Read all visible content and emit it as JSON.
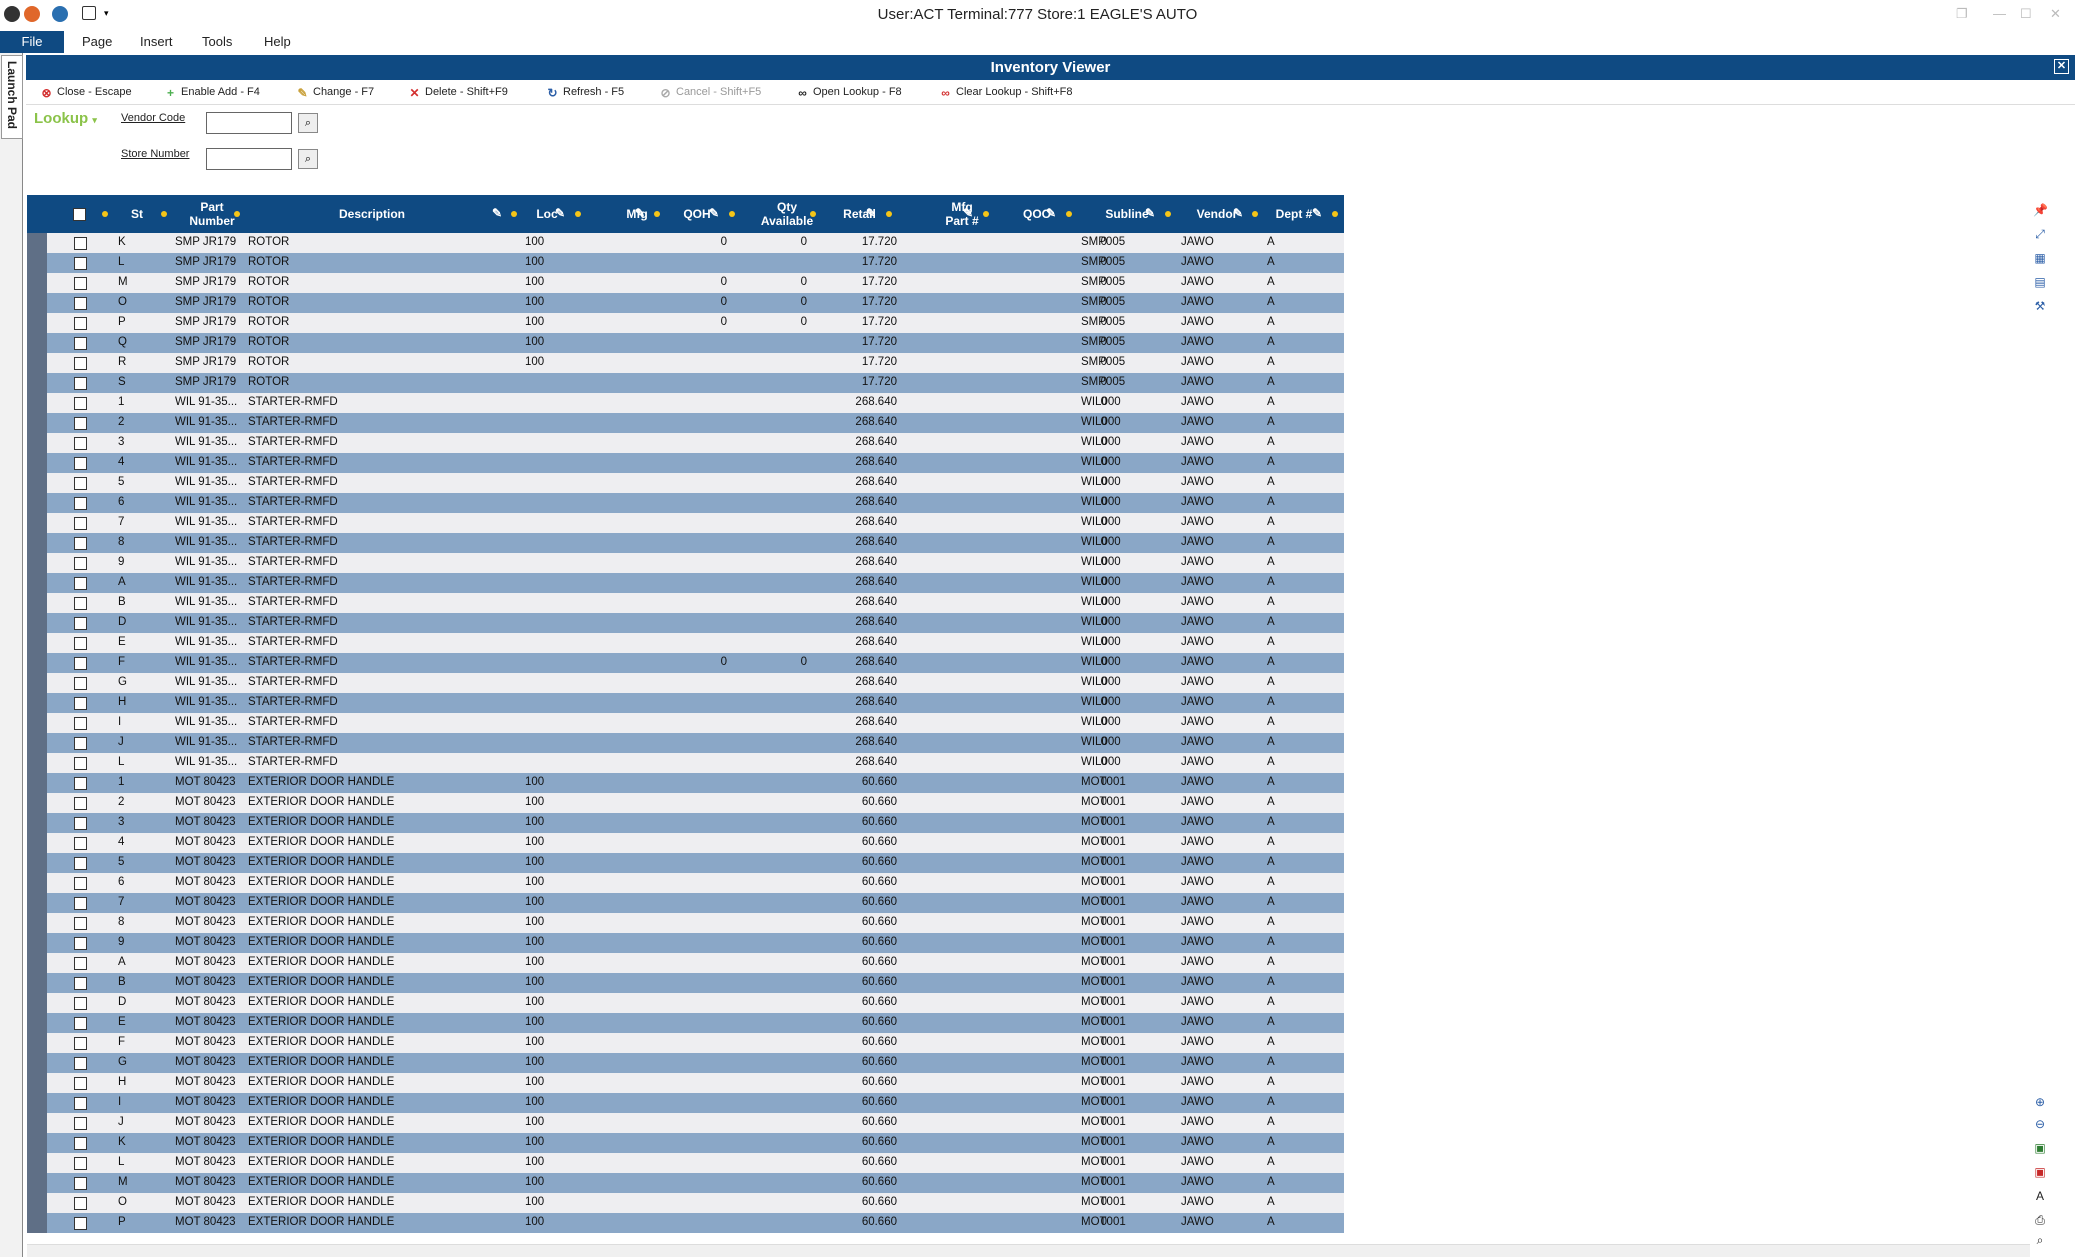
{
  "window": {
    "title": "User:ACT Terminal:777 Store:1 EAGLE'S AUTO"
  },
  "menu": {
    "file": "File",
    "page": "Page",
    "insert": "Insert",
    "tools": "Tools",
    "help": "Help"
  },
  "launch_pad": "Launch Pad",
  "panel": {
    "title": "Inventory Viewer",
    "close": "✕"
  },
  "toolbar": {
    "close": "Close - Escape",
    "enable_add": "Enable Add - F4",
    "change": "Change - F7",
    "delete": "Delete - Shift+F9",
    "refresh": "Refresh - F5",
    "cancel": "Cancel - Shift+F5",
    "open_lookup": "Open Lookup - F8",
    "clear_lookup": "Clear Lookup - Shift+F8"
  },
  "lookup": {
    "title": "Lookup",
    "vendor_code_label": "Vendor Code",
    "vendor_code_value": "",
    "store_number_label": "Store Number",
    "store_number_value": ""
  },
  "columns": {
    "st": "St",
    "part_number_1": "Part",
    "part_number_2": "Number",
    "description": "Description",
    "loc": "Loc",
    "mfg": "Mfg",
    "qoh": "QOH",
    "qty_available_1": "Qty",
    "qty_available_2": "Available",
    "retail": "Retail",
    "mfg_part_1": "Mfg",
    "mfg_part_2": "Part #",
    "qoo": "QOO",
    "subline": "Subline",
    "vendor": "Vendor",
    "dept": "Dept #"
  },
  "rows": [
    {
      "st": "K",
      "part": "SMP JR179",
      "desc": "ROTOR",
      "loc": "100",
      "qoh": "0",
      "qty": "0",
      "retail": "17.720",
      "qoo": "0",
      "subline": "SMP005",
      "vendor": "JAWO",
      "dept": "A"
    },
    {
      "st": "L",
      "part": "SMP JR179",
      "desc": "ROTOR",
      "loc": "100",
      "qoh": "",
      "qty": "",
      "retail": "17.720",
      "qoo": "0",
      "subline": "SMP005",
      "vendor": "JAWO",
      "dept": "A"
    },
    {
      "st": "M",
      "part": "SMP JR179",
      "desc": "ROTOR",
      "loc": "100",
      "qoh": "0",
      "qty": "0",
      "retail": "17.720",
      "qoo": "0",
      "subline": "SMP005",
      "vendor": "JAWO",
      "dept": "A"
    },
    {
      "st": "O",
      "part": "SMP JR179",
      "desc": "ROTOR",
      "loc": "100",
      "qoh": "0",
      "qty": "0",
      "retail": "17.720",
      "qoo": "0",
      "subline": "SMP005",
      "vendor": "JAWO",
      "dept": "A"
    },
    {
      "st": "P",
      "part": "SMP JR179",
      "desc": "ROTOR",
      "loc": "100",
      "qoh": "0",
      "qty": "0",
      "retail": "17.720",
      "qoo": "0",
      "subline": "SMP005",
      "vendor": "JAWO",
      "dept": "A"
    },
    {
      "st": "Q",
      "part": "SMP JR179",
      "desc": "ROTOR",
      "loc": "100",
      "qoh": "",
      "qty": "",
      "retail": "17.720",
      "qoo": "0",
      "subline": "SMP005",
      "vendor": "JAWO",
      "dept": "A"
    },
    {
      "st": "R",
      "part": "SMP JR179",
      "desc": "ROTOR",
      "loc": "100",
      "qoh": "",
      "qty": "",
      "retail": "17.720",
      "qoo": "0",
      "subline": "SMP005",
      "vendor": "JAWO",
      "dept": "A"
    },
    {
      "st": "S",
      "part": "SMP JR179",
      "desc": "ROTOR",
      "loc": "",
      "qoh": "",
      "qty": "",
      "retail": "17.720",
      "qoo": "0",
      "subline": "SMP005",
      "vendor": "JAWO",
      "dept": "A"
    },
    {
      "st": "1",
      "part": "WIL 91-35...",
      "desc": "STARTER-RMFD",
      "loc": "",
      "qoh": "",
      "qty": "",
      "retail": "268.640",
      "qoo": "0",
      "subline": "WIL000",
      "vendor": "JAWO",
      "dept": "A"
    },
    {
      "st": "2",
      "part": "WIL 91-35...",
      "desc": "STARTER-RMFD",
      "loc": "",
      "qoh": "",
      "qty": "",
      "retail": "268.640",
      "qoo": "0",
      "subline": "WIL000",
      "vendor": "JAWO",
      "dept": "A"
    },
    {
      "st": "3",
      "part": "WIL 91-35...",
      "desc": "STARTER-RMFD",
      "loc": "",
      "qoh": "",
      "qty": "",
      "retail": "268.640",
      "qoo": "0",
      "subline": "WIL000",
      "vendor": "JAWO",
      "dept": "A"
    },
    {
      "st": "4",
      "part": "WIL 91-35...",
      "desc": "STARTER-RMFD",
      "loc": "",
      "qoh": "",
      "qty": "",
      "retail": "268.640",
      "qoo": "0",
      "subline": "WIL000",
      "vendor": "JAWO",
      "dept": "A"
    },
    {
      "st": "5",
      "part": "WIL 91-35...",
      "desc": "STARTER-RMFD",
      "loc": "",
      "qoh": "",
      "qty": "",
      "retail": "268.640",
      "qoo": "0",
      "subline": "WIL000",
      "vendor": "JAWO",
      "dept": "A"
    },
    {
      "st": "6",
      "part": "WIL 91-35...",
      "desc": "STARTER-RMFD",
      "loc": "",
      "qoh": "",
      "qty": "",
      "retail": "268.640",
      "qoo": "0",
      "subline": "WIL000",
      "vendor": "JAWO",
      "dept": "A"
    },
    {
      "st": "7",
      "part": "WIL 91-35...",
      "desc": "STARTER-RMFD",
      "loc": "",
      "qoh": "",
      "qty": "",
      "retail": "268.640",
      "qoo": "0",
      "subline": "WIL000",
      "vendor": "JAWO",
      "dept": "A"
    },
    {
      "st": "8",
      "part": "WIL 91-35...",
      "desc": "STARTER-RMFD",
      "loc": "",
      "qoh": "",
      "qty": "",
      "retail": "268.640",
      "qoo": "0",
      "subline": "WIL000",
      "vendor": "JAWO",
      "dept": "A"
    },
    {
      "st": "9",
      "part": "WIL 91-35...",
      "desc": "STARTER-RMFD",
      "loc": "",
      "qoh": "",
      "qty": "",
      "retail": "268.640",
      "qoo": "0",
      "subline": "WIL000",
      "vendor": "JAWO",
      "dept": "A"
    },
    {
      "st": "A",
      "part": "WIL 91-35...",
      "desc": "STARTER-RMFD",
      "loc": "",
      "qoh": "",
      "qty": "",
      "retail": "268.640",
      "qoo": "0",
      "subline": "WIL000",
      "vendor": "JAWO",
      "dept": "A"
    },
    {
      "st": "B",
      "part": "WIL 91-35...",
      "desc": "STARTER-RMFD",
      "loc": "",
      "qoh": "",
      "qty": "",
      "retail": "268.640",
      "qoo": "0",
      "subline": "WIL000",
      "vendor": "JAWO",
      "dept": "A"
    },
    {
      "st": "D",
      "part": "WIL 91-35...",
      "desc": "STARTER-RMFD",
      "loc": "",
      "qoh": "",
      "qty": "",
      "retail": "268.640",
      "qoo": "0",
      "subline": "WIL000",
      "vendor": "JAWO",
      "dept": "A"
    },
    {
      "st": "E",
      "part": "WIL 91-35...",
      "desc": "STARTER-RMFD",
      "loc": "",
      "qoh": "",
      "qty": "",
      "retail": "268.640",
      "qoo": "0",
      "subline": "WIL000",
      "vendor": "JAWO",
      "dept": "A"
    },
    {
      "st": "F",
      "part": "WIL 91-35...",
      "desc": "STARTER-RMFD",
      "loc": "",
      "qoh": "0",
      "qty": "0",
      "retail": "268.640",
      "qoo": "0",
      "subline": "WIL000",
      "vendor": "JAWO",
      "dept": "A"
    },
    {
      "st": "G",
      "part": "WIL 91-35...",
      "desc": "STARTER-RMFD",
      "loc": "",
      "qoh": "",
      "qty": "",
      "retail": "268.640",
      "qoo": "0",
      "subline": "WIL000",
      "vendor": "JAWO",
      "dept": "A"
    },
    {
      "st": "H",
      "part": "WIL 91-35...",
      "desc": "STARTER-RMFD",
      "loc": "",
      "qoh": "",
      "qty": "",
      "retail": "268.640",
      "qoo": "0",
      "subline": "WIL000",
      "vendor": "JAWO",
      "dept": "A"
    },
    {
      "st": "I",
      "part": "WIL 91-35...",
      "desc": "STARTER-RMFD",
      "loc": "",
      "qoh": "",
      "qty": "",
      "retail": "268.640",
      "qoo": "0",
      "subline": "WIL000",
      "vendor": "JAWO",
      "dept": "A"
    },
    {
      "st": "J",
      "part": "WIL 91-35...",
      "desc": "STARTER-RMFD",
      "loc": "",
      "qoh": "",
      "qty": "",
      "retail": "268.640",
      "qoo": "0",
      "subline": "WIL000",
      "vendor": "JAWO",
      "dept": "A"
    },
    {
      "st": "L",
      "part": "WIL 91-35...",
      "desc": "STARTER-RMFD",
      "loc": "",
      "qoh": "",
      "qty": "",
      "retail": "268.640",
      "qoo": "0",
      "subline": "WIL000",
      "vendor": "JAWO",
      "dept": "A"
    },
    {
      "st": "1",
      "part": "MOT 80423",
      "desc": "EXTERIOR DOOR HANDLE",
      "loc": "100",
      "qoh": "",
      "qty": "",
      "retail": "60.660",
      "qoo": "0",
      "subline": "MOT001",
      "vendor": "JAWO",
      "dept": "A"
    },
    {
      "st": "2",
      "part": "MOT 80423",
      "desc": "EXTERIOR DOOR HANDLE",
      "loc": "100",
      "qoh": "",
      "qty": "",
      "retail": "60.660",
      "qoo": "0",
      "subline": "MOT001",
      "vendor": "JAWO",
      "dept": "A"
    },
    {
      "st": "3",
      "part": "MOT 80423",
      "desc": "EXTERIOR DOOR HANDLE",
      "loc": "100",
      "qoh": "",
      "qty": "",
      "retail": "60.660",
      "qoo": "0",
      "subline": "MOT001",
      "vendor": "JAWO",
      "dept": "A"
    },
    {
      "st": "4",
      "part": "MOT 80423",
      "desc": "EXTERIOR DOOR HANDLE",
      "loc": "100",
      "qoh": "",
      "qty": "",
      "retail": "60.660",
      "qoo": "0",
      "subline": "MOT001",
      "vendor": "JAWO",
      "dept": "A"
    },
    {
      "st": "5",
      "part": "MOT 80423",
      "desc": "EXTERIOR DOOR HANDLE",
      "loc": "100",
      "qoh": "",
      "qty": "",
      "retail": "60.660",
      "qoo": "0",
      "subline": "MOT001",
      "vendor": "JAWO",
      "dept": "A"
    },
    {
      "st": "6",
      "part": "MOT 80423",
      "desc": "EXTERIOR DOOR HANDLE",
      "loc": "100",
      "qoh": "",
      "qty": "",
      "retail": "60.660",
      "qoo": "0",
      "subline": "MOT001",
      "vendor": "JAWO",
      "dept": "A"
    },
    {
      "st": "7",
      "part": "MOT 80423",
      "desc": "EXTERIOR DOOR HANDLE",
      "loc": "100",
      "qoh": "",
      "qty": "",
      "retail": "60.660",
      "qoo": "0",
      "subline": "MOT001",
      "vendor": "JAWO",
      "dept": "A"
    },
    {
      "st": "8",
      "part": "MOT 80423",
      "desc": "EXTERIOR DOOR HANDLE",
      "loc": "100",
      "qoh": "",
      "qty": "",
      "retail": "60.660",
      "qoo": "0",
      "subline": "MOT001",
      "vendor": "JAWO",
      "dept": "A"
    },
    {
      "st": "9",
      "part": "MOT 80423",
      "desc": "EXTERIOR DOOR HANDLE",
      "loc": "100",
      "qoh": "",
      "qty": "",
      "retail": "60.660",
      "qoo": "0",
      "subline": "MOT001",
      "vendor": "JAWO",
      "dept": "A"
    },
    {
      "st": "A",
      "part": "MOT 80423",
      "desc": "EXTERIOR DOOR HANDLE",
      "loc": "100",
      "qoh": "",
      "qty": "",
      "retail": "60.660",
      "qoo": "0",
      "subline": "MOT001",
      "vendor": "JAWO",
      "dept": "A"
    },
    {
      "st": "B",
      "part": "MOT 80423",
      "desc": "EXTERIOR DOOR HANDLE",
      "loc": "100",
      "qoh": "",
      "qty": "",
      "retail": "60.660",
      "qoo": "0",
      "subline": "MOT001",
      "vendor": "JAWO",
      "dept": "A"
    },
    {
      "st": "D",
      "part": "MOT 80423",
      "desc": "EXTERIOR DOOR HANDLE",
      "loc": "100",
      "qoh": "",
      "qty": "",
      "retail": "60.660",
      "qoo": "0",
      "subline": "MOT001",
      "vendor": "JAWO",
      "dept": "A"
    },
    {
      "st": "E",
      "part": "MOT 80423",
      "desc": "EXTERIOR DOOR HANDLE",
      "loc": "100",
      "qoh": "",
      "qty": "",
      "retail": "60.660",
      "qoo": "0",
      "subline": "MOT001",
      "vendor": "JAWO",
      "dept": "A"
    },
    {
      "st": "F",
      "part": "MOT 80423",
      "desc": "EXTERIOR DOOR HANDLE",
      "loc": "100",
      "qoh": "",
      "qty": "",
      "retail": "60.660",
      "qoo": "0",
      "subline": "MOT001",
      "vendor": "JAWO",
      "dept": "A"
    },
    {
      "st": "G",
      "part": "MOT 80423",
      "desc": "EXTERIOR DOOR HANDLE",
      "loc": "100",
      "qoh": "",
      "qty": "",
      "retail": "60.660",
      "qoo": "0",
      "subline": "MOT001",
      "vendor": "JAWO",
      "dept": "A"
    },
    {
      "st": "H",
      "part": "MOT 80423",
      "desc": "EXTERIOR DOOR HANDLE",
      "loc": "100",
      "qoh": "",
      "qty": "",
      "retail": "60.660",
      "qoo": "0",
      "subline": "MOT001",
      "vendor": "JAWO",
      "dept": "A"
    },
    {
      "st": "I",
      "part": "MOT 80423",
      "desc": "EXTERIOR DOOR HANDLE",
      "loc": "100",
      "qoh": "",
      "qty": "",
      "retail": "60.660",
      "qoo": "0",
      "subline": "MOT001",
      "vendor": "JAWO",
      "dept": "A"
    },
    {
      "st": "J",
      "part": "MOT 80423",
      "desc": "EXTERIOR DOOR HANDLE",
      "loc": "100",
      "qoh": "",
      "qty": "",
      "retail": "60.660",
      "qoo": "0",
      "subline": "MOT001",
      "vendor": "JAWO",
      "dept": "A"
    },
    {
      "st": "K",
      "part": "MOT 80423",
      "desc": "EXTERIOR DOOR HANDLE",
      "loc": "100",
      "qoh": "",
      "qty": "",
      "retail": "60.660",
      "qoo": "0",
      "subline": "MOT001",
      "vendor": "JAWO",
      "dept": "A"
    },
    {
      "st": "L",
      "part": "MOT 80423",
      "desc": "EXTERIOR DOOR HANDLE",
      "loc": "100",
      "qoh": "",
      "qty": "",
      "retail": "60.660",
      "qoo": "0",
      "subline": "MOT001",
      "vendor": "JAWO",
      "dept": "A"
    },
    {
      "st": "M",
      "part": "MOT 80423",
      "desc": "EXTERIOR DOOR HANDLE",
      "loc": "100",
      "qoh": "",
      "qty": "",
      "retail": "60.660",
      "qoo": "0",
      "subline": "MOT001",
      "vendor": "JAWO",
      "dept": "A"
    },
    {
      "st": "O",
      "part": "MOT 80423",
      "desc": "EXTERIOR DOOR HANDLE",
      "loc": "100",
      "qoh": "",
      "qty": "",
      "retail": "60.660",
      "qoo": "0",
      "subline": "MOT001",
      "vendor": "JAWO",
      "dept": "A"
    },
    {
      "st": "P",
      "part": "MOT 80423",
      "desc": "EXTERIOR DOOR HANDLE",
      "loc": "100",
      "qoh": "",
      "qty": "",
      "retail": "60.660",
      "qoo": "0",
      "subline": "MOT001",
      "vendor": "JAWO",
      "dept": "A"
    }
  ],
  "colors": {
    "accent": "#0f4a82",
    "row_alt": "#8aa7c7",
    "row": "#eeeef1",
    "lookup": "#8bc34a"
  }
}
